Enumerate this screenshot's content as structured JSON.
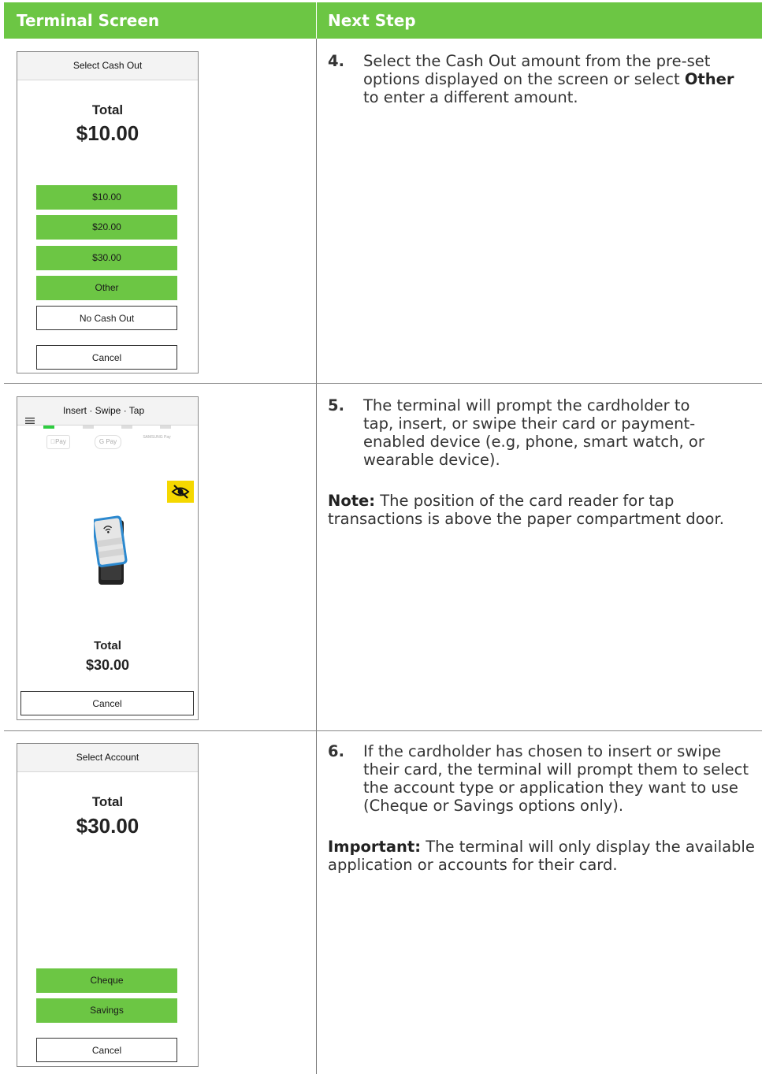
{
  "header": {
    "col1": "Terminal Screen",
    "col2": "Next Step"
  },
  "rows": [
    {
      "screen": {
        "title": "Select Cash Out",
        "total_label": "Total",
        "total_amount": "$10.00",
        "options": [
          "$10.00",
          "$20.00",
          "$30.00",
          "Other"
        ],
        "no_cash_out": "No Cash Out",
        "cancel": "Cancel"
      },
      "step": {
        "number": "4.",
        "text_before": "Select the Cash Out amount from the pre-set options displayed on the screen or select ",
        "bold": "Other",
        "text_after": " to enter a different amount."
      }
    },
    {
      "screen": {
        "menu_icon": "hamburger-menu-icon",
        "title": "Insert · Swipe · Tap",
        "pay_methods": [
          "Pay",
          "G Pay",
          "SAMSUNG Pay"
        ],
        "privacy_icon": "eye-slash-icon",
        "total_label": "Total",
        "total_amount": "$30.00",
        "cancel": "Cancel"
      },
      "step": {
        "number": "5.",
        "text": "The terminal will prompt the cardholder to tap, insert, or swipe their card or payment-enabled device (e.g, phone, smart watch, or wearable device)."
      },
      "note": {
        "label": "Note:",
        "text": " The position of the card reader for tap transactions is above the paper compartment door."
      }
    },
    {
      "screen": {
        "title": "Select Account",
        "total_label": "Total",
        "total_amount": "$30.00",
        "options": [
          "Cheque",
          "Savings"
        ],
        "cancel": "Cancel"
      },
      "step": {
        "number": "6.",
        "text": "If the cardholder has chosen to insert or swipe their card, the terminal will prompt them to select the account type or application they want to use (Cheque or Savings options only)."
      },
      "important": {
        "label": "Important:",
        "text": " The terminal will only display the available application or accounts for their card."
      }
    }
  ],
  "colors": {
    "accent_green": "#6cc644",
    "active_indicator": "#2ecc40",
    "privacy_yellow": "#f5d800"
  }
}
